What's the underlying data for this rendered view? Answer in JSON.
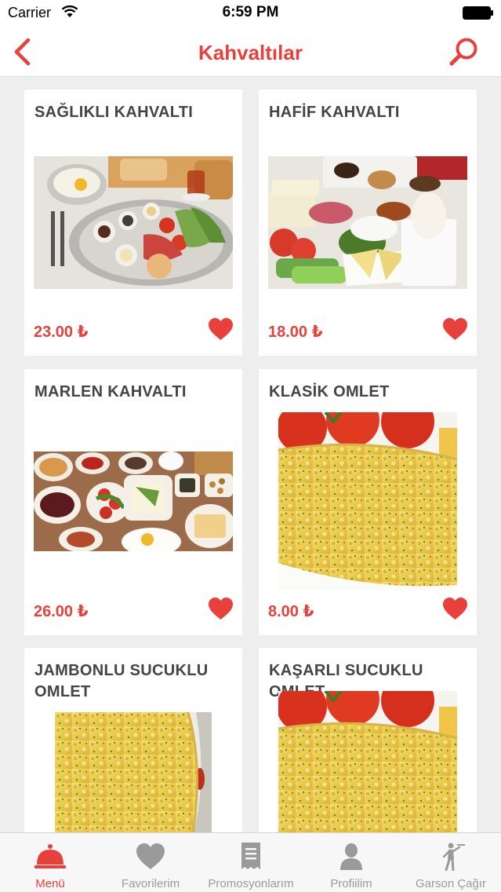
{
  "status_bar": {
    "carrier": "Carrier",
    "time": "6:59 PM"
  },
  "nav": {
    "title": "Kahvaltılar",
    "back_icon": "chevron-left-icon",
    "search_icon": "search-icon"
  },
  "colors": {
    "accent": "#e8403a",
    "title_text": "#444444",
    "tab_inactive": "#9a9a9a",
    "background": "#eeeeee"
  },
  "products": [
    {
      "name": "SAĞLIKLI KAHVALTI",
      "price": "23.00 ₺",
      "image": "breakfast-platter-photo"
    },
    {
      "name": "HAFİF KAHVALTI",
      "price": "18.00 ₺",
      "image": "light-breakfast-photo"
    },
    {
      "name": "MARLEN KAHVALTI",
      "price": "26.00 ₺",
      "image": "breakfast-spread-photo"
    },
    {
      "name": "KLASİK OMLET",
      "price": "8.00 ₺",
      "image": "omelet-photo"
    },
    {
      "name": "JAMBONLU SUCUKLU OMLET",
      "price": "",
      "image": "omelet-photo"
    },
    {
      "name": "KAŞARLI SUCUKLU OMLET",
      "price": "",
      "image": "omelet-photo"
    }
  ],
  "tabs": [
    {
      "label": "Menü",
      "icon": "cloche-icon",
      "active": true
    },
    {
      "label": "Favorilerim",
      "icon": "heart-icon",
      "active": false
    },
    {
      "label": "Promosyonlarım",
      "icon": "receipt-icon",
      "active": false
    },
    {
      "label": "Profiilim",
      "icon": "user-icon",
      "active": false
    },
    {
      "label": "Garson Çağır",
      "icon": "waiter-icon",
      "active": false
    }
  ]
}
